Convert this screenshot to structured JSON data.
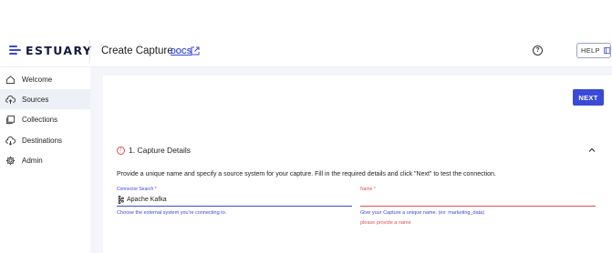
{
  "header": {
    "logo_text": "ESTUARY",
    "page_title": "Create Capture",
    "docs_label": "DOCS",
    "help_label": "HELP"
  },
  "sidebar": {
    "items": [
      {
        "label": "Welcome",
        "icon": "home-icon"
      },
      {
        "label": "Sources",
        "icon": "cloud-upload-icon",
        "active": true
      },
      {
        "label": "Collections",
        "icon": "collections-icon"
      },
      {
        "label": "Destinations",
        "icon": "cloud-download-icon"
      },
      {
        "label": "Admin",
        "icon": "gear-icon"
      }
    ]
  },
  "main": {
    "next_label": "NEXT",
    "section_title": "1. Capture Details",
    "intro": "Provide a unique name and specify a source system for your capture. Fill in the required details and click \"Next\" to test the connection.",
    "connector_field": {
      "label": "Connector Search *",
      "value": "Apache Kafka",
      "helper": "Choose the external system you're connecting to."
    },
    "name_field": {
      "label": "Name *",
      "value": "",
      "helper": "Give your Capture a unique name. (ex: marketing_data)",
      "error": "please provide a name"
    }
  },
  "colors": {
    "accent": "#3a4ad6",
    "error": "#d9534f",
    "content_bg": "#f4f5fa",
    "active_nav_bg": "#eef0f7"
  }
}
